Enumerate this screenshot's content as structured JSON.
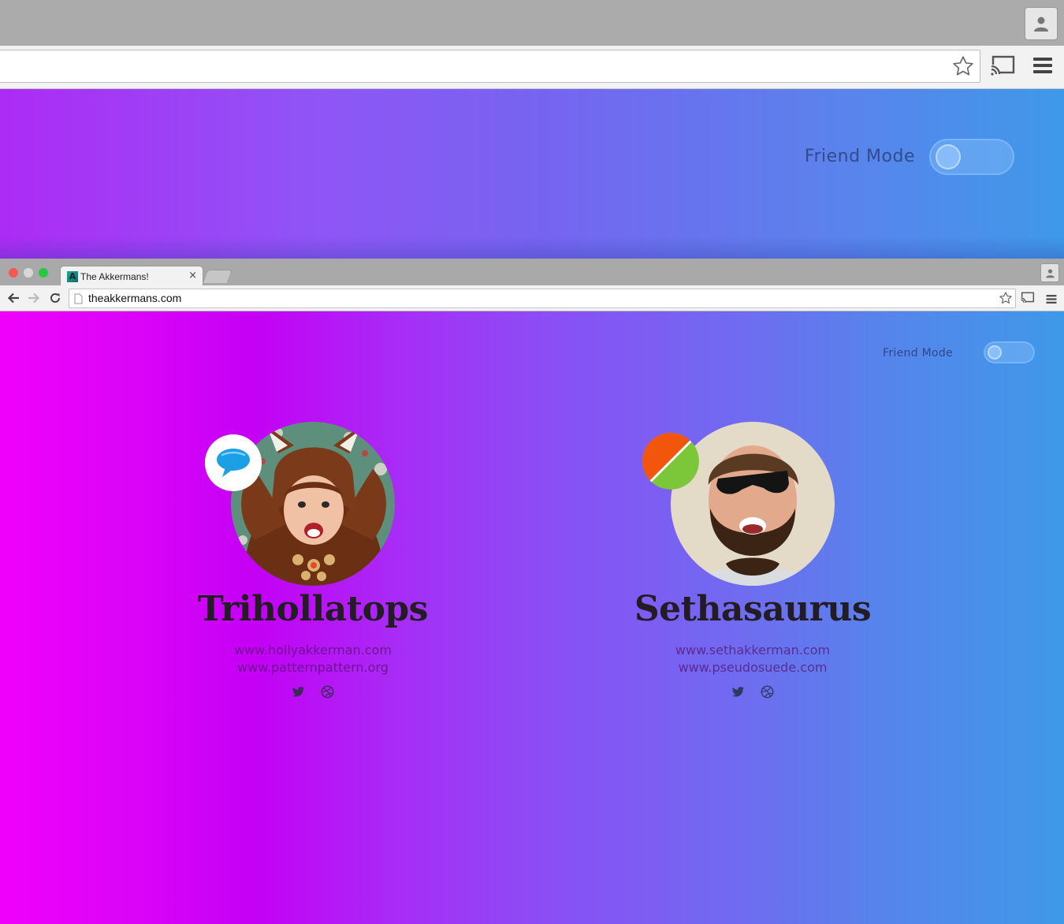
{
  "big_browser": {
    "friend_mode_label": "Friend Mode",
    "toggle_on": false
  },
  "browser": {
    "tab_title": "The Akkermans!",
    "tab_favicon": "A",
    "tab_close": "×",
    "url": "theakkermans.com"
  },
  "page": {
    "friend_mode_label": "Friend Mode",
    "toggle_on": false,
    "people": [
      {
        "name": "Trihollatops",
        "links": [
          "www.hollyakkerman.com",
          "www.patternpattern.org"
        ],
        "badge_icon": "speech-bubble-icon",
        "socials": [
          "twitter-icon",
          "dribbble-icon"
        ]
      },
      {
        "name": "Sethasaurus",
        "links": [
          "www.sethakkerman.com",
          "www.pseudosuede.com"
        ],
        "badge_icon": "split-circle-icon",
        "socials": [
          "twitter-icon",
          "dribbble-icon"
        ]
      }
    ]
  },
  "colors": {
    "gradient_start": "#f000fb",
    "gradient_end": "#3f99e9",
    "name_text": "#231c25",
    "badge_orange": "#f2560c",
    "badge_green": "#7cc63a",
    "speech_blue": "#1ba0e6"
  }
}
